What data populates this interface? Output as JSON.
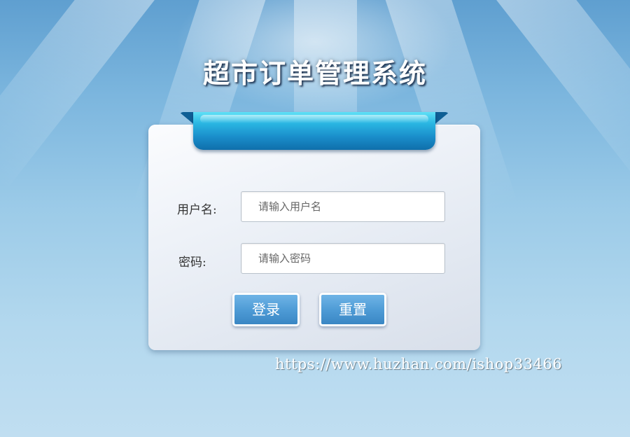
{
  "app": {
    "title": "超市订单管理系统"
  },
  "login_form": {
    "username_label": "用户名:",
    "username_placeholder": "请输入用户名",
    "username_value": "",
    "password_label": "密码:",
    "password_placeholder": "请输入密码",
    "password_value": "",
    "login_label": "登录",
    "reset_label": "重置"
  },
  "watermark": {
    "text": "https://www.huzhan.com/ishop33466"
  },
  "colors": {
    "background_top": "#5f9fd0",
    "background_bottom": "#c0def1",
    "ribbon": "#1a8ecb",
    "button": "#4f9cd6"
  }
}
